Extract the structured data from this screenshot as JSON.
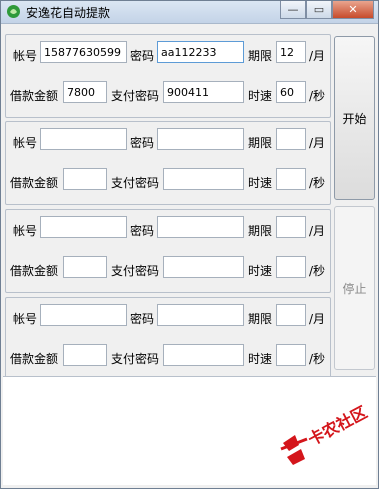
{
  "window": {
    "title": "安逸花自动提款",
    "close_label": "✕",
    "min_label": "—",
    "max_label": "▭"
  },
  "labels": {
    "account": "帐号",
    "password": "密码",
    "term": "期限",
    "per_month": "/月",
    "loan_amount": "借款金额",
    "pay_password": "支付密码",
    "speed": "时速",
    "per_second": "/秒"
  },
  "groups": [
    {
      "account": "15877630599",
      "password": "aa112233",
      "term": "12",
      "amount": "7800",
      "pay_password": "900411",
      "speed": "60"
    },
    {
      "account": "",
      "password": "",
      "term": "",
      "amount": "",
      "pay_password": "",
      "speed": ""
    },
    {
      "account": "",
      "password": "",
      "term": "",
      "amount": "",
      "pay_password": "",
      "speed": ""
    },
    {
      "account": "",
      "password": "",
      "term": "",
      "amount": "",
      "pay_password": "",
      "speed": ""
    }
  ],
  "buttons": {
    "start": "开始",
    "stop": "停止"
  },
  "watermark": {
    "text": "卡农社区",
    "color": "#d4151b"
  },
  "colors": {
    "title_bar": "#c3d3e7",
    "close_button": "#c74b2b",
    "focus_border": "#5d9bd6"
  }
}
